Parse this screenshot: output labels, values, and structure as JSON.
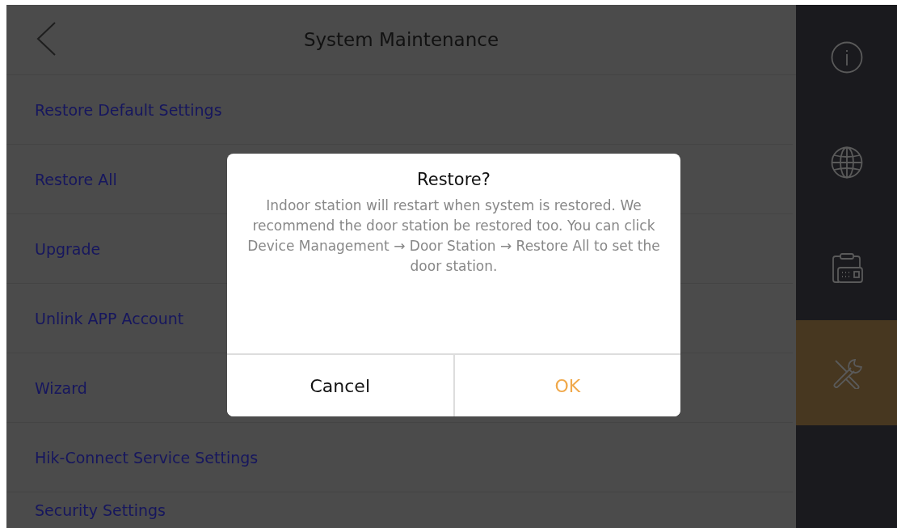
{
  "header": {
    "title": "System Maintenance"
  },
  "menu": [
    {
      "label": "Restore Default Settings"
    },
    {
      "label": "Restore All"
    },
    {
      "label": "Upgrade"
    },
    {
      "label": "Unlink APP Account"
    },
    {
      "label": "Wizard"
    },
    {
      "label": "Hik-Connect Service Settings"
    },
    {
      "label": "Security Settings"
    }
  ],
  "sidebar": [
    {
      "selected": false
    },
    {
      "selected": false
    },
    {
      "selected": false
    },
    {
      "selected": true
    }
  ],
  "dialog": {
    "title": "Restore?",
    "message": "Indoor station will restart when system is restored. We recommend the door station be restored too. You can click Device Management → Door Station → Restore All to set the door station.",
    "buttons": [
      {
        "label": "Cancel",
        "kind": "cancel"
      },
      {
        "label": "OK",
        "kind": "confirm"
      }
    ]
  }
}
